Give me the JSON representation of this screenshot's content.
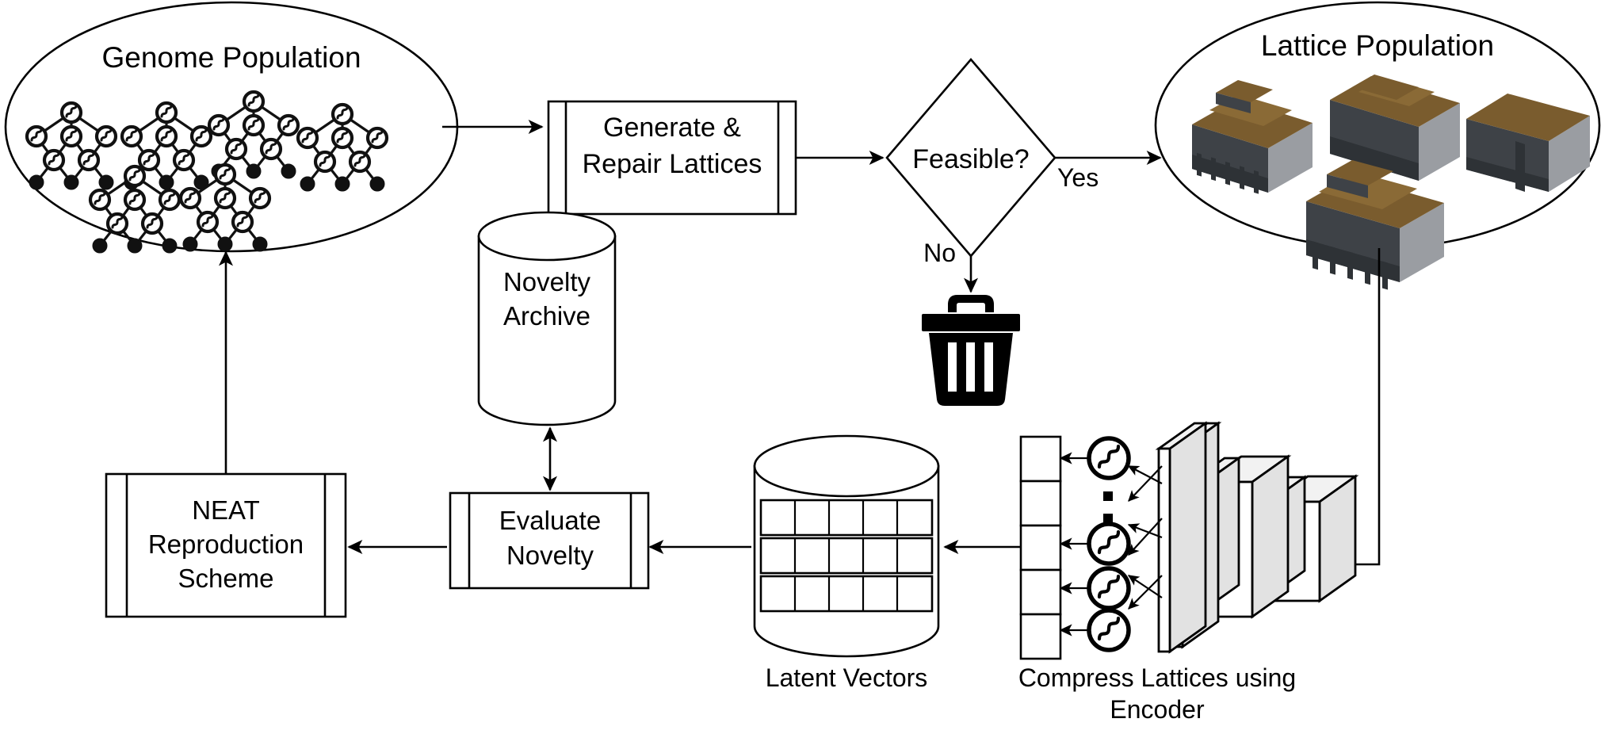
{
  "diagram": {
    "title": "Genome / Lattice evolutionary pipeline",
    "accent_colors": {
      "stroke": "#000000",
      "background": "#ffffff",
      "cnn_side": "#e2e2e2",
      "lattice_top": "#7a5c2e",
      "lattice_front": "#3e4247",
      "lattice_side": "#9a9da2"
    }
  },
  "nodes": {
    "genome_population": {
      "label": "Genome Population",
      "shape": "ellipse",
      "genome_count": 6
    },
    "generate_repair": {
      "label_line1": "Generate &",
      "label_line2": "Repair Lattices",
      "shape": "predefined-process"
    },
    "feasible": {
      "label": "Feasible?",
      "shape": "decision",
      "edge_yes": "Yes",
      "edge_no": "No"
    },
    "discard": {
      "label": "trash-can",
      "shape": "icon"
    },
    "lattice_population": {
      "label": "Lattice Population",
      "shape": "ellipse",
      "lattice_count": 4
    },
    "encoder": {
      "caption_line1": "Compress Lattices using",
      "caption_line2": "Encoder",
      "shape": "cnn-stack",
      "activation_icon": "sigmoid-icon",
      "activation_count": 4,
      "latent_cells": 5,
      "ellipsis": "vertical-dots"
    },
    "latent_vectors": {
      "caption": "Latent Vectors",
      "shape": "cylinder-table",
      "rows": 3,
      "cols": 5
    },
    "evaluate_novelty": {
      "label_line1": "Evaluate",
      "label_line2": "Novelty",
      "shape": "predefined-process"
    },
    "novelty_archive": {
      "label_line1": "Novelty",
      "label_line2": "Archive",
      "shape": "cylinder"
    },
    "neat_reproduction": {
      "label_line1": "NEAT",
      "label_line2": "Reproduction",
      "label_line3": "Scheme",
      "shape": "predefined-process"
    }
  },
  "edges": [
    {
      "from": "genome_population",
      "to": "generate_repair",
      "label": ""
    },
    {
      "from": "generate_repair",
      "to": "feasible",
      "label": ""
    },
    {
      "from": "feasible",
      "to": "lattice_population",
      "label": "Yes"
    },
    {
      "from": "feasible",
      "to": "discard",
      "label": "No"
    },
    {
      "from": "lattice_population",
      "to": "encoder",
      "label": ""
    },
    {
      "from": "encoder",
      "to": "latent_vectors",
      "label": ""
    },
    {
      "from": "latent_vectors",
      "to": "evaluate_novelty",
      "label": ""
    },
    {
      "from": "evaluate_novelty",
      "to": "novelty_archive",
      "label": "",
      "bidirectional": true
    },
    {
      "from": "evaluate_novelty",
      "to": "neat_reproduction",
      "label": ""
    },
    {
      "from": "neat_reproduction",
      "to": "genome_population",
      "label": ""
    }
  ]
}
